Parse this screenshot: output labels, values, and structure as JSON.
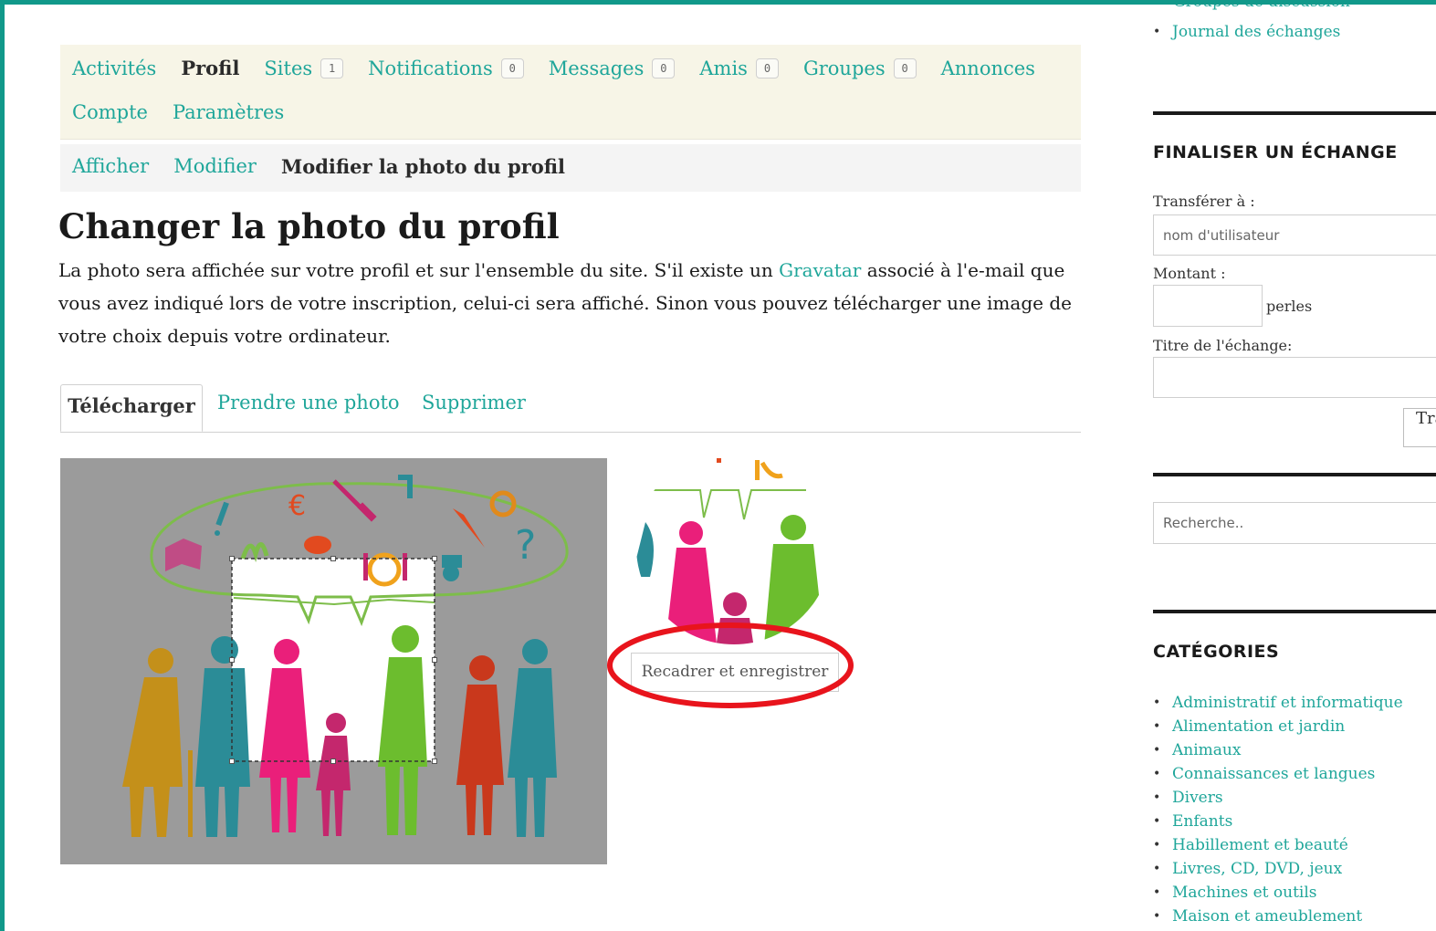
{
  "nav": {
    "primary": [
      {
        "label": "Activités",
        "current": false
      },
      {
        "label": "Profil",
        "current": true
      },
      {
        "label": "Sites",
        "count": "1",
        "current": false
      },
      {
        "label": "Notifications",
        "count": "0",
        "current": false
      },
      {
        "label": "Messages",
        "count": "0",
        "current": false
      },
      {
        "label": "Amis",
        "count": "0",
        "current": false
      },
      {
        "label": "Groupes",
        "count": "0",
        "current": false
      },
      {
        "label": "Annonces",
        "current": false
      }
    ],
    "primary_row2": [
      {
        "label": "Compte"
      },
      {
        "label": "Paramètres"
      }
    ],
    "secondary": [
      {
        "label": "Afficher",
        "current": false
      },
      {
        "label": "Modifier",
        "current": false
      },
      {
        "label": "Modifier la photo du profil",
        "current": true
      }
    ]
  },
  "main": {
    "title": "Changer la photo du profil",
    "description_before": "La photo sera affichée sur votre profil et sur l'ensemble du site. S'il existe un ",
    "description_link": "Gravatar",
    "description_after": " associé à l'e-mail que vous avez indiqué lors de votre inscription, celui-ci sera affiché. Sinon vous pouvez télécharger une image de votre choix depuis votre ordinateur.",
    "tabs": [
      {
        "label": "Télécharger",
        "active": true
      },
      {
        "label": "Prendre une photo",
        "active": false
      },
      {
        "label": "Supprimer",
        "active": false
      }
    ],
    "crop_button": "Recadrer et enregistrer",
    "highlight_color": "#e8141c"
  },
  "sidebar": {
    "cut_item": "Groupes de discussion",
    "top_links": [
      "Journal des échanges"
    ],
    "exchange_widget": {
      "title": "FINALISER UN ÉCHANGE",
      "transfer_label": "Transférer à :",
      "transfer_placeholder": "nom d'utilisateur",
      "amount_label": "Montant :",
      "amount_unit": "perles",
      "exchange_title_label": "Titre de l'échange:",
      "submit_label": "Transférer"
    },
    "search_placeholder": "Recherche..",
    "categories": {
      "title": "CATÉGORIES",
      "items": [
        "Administratif et informatique",
        "Alimentation et jardin",
        "Animaux",
        "Connaissances et langues",
        "Divers",
        "Enfants",
        "Habillement et beauté",
        "Livres, CD, DVD, jeux",
        "Machines et outils",
        "Maison et ameublement"
      ]
    }
  },
  "colors": {
    "frame": "#11998a",
    "link": "#1fa69a",
    "nav_bg": "#f7f5e7"
  }
}
